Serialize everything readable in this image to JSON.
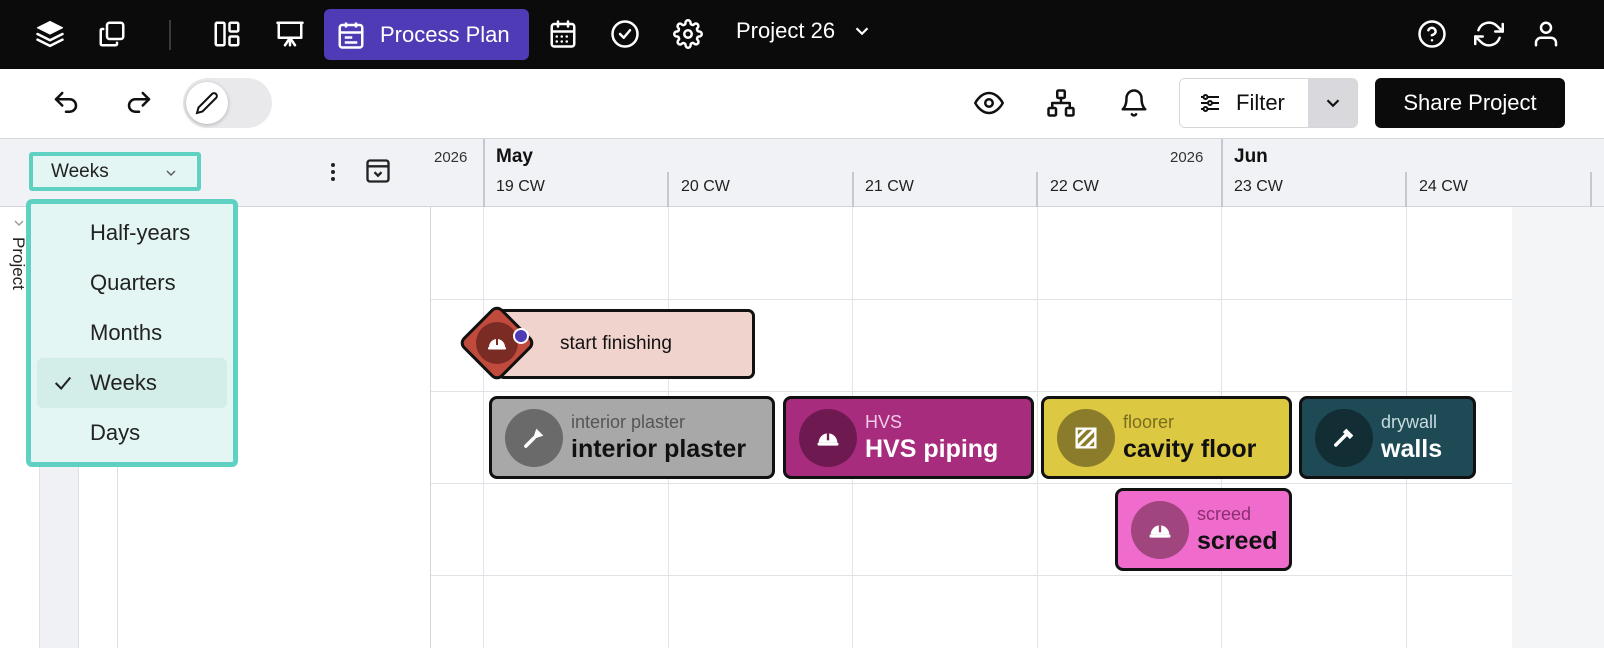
{
  "topbar": {
    "icons": [
      "layers-icon",
      "copy-icon",
      "dashboard-icon",
      "presentation-icon",
      "process-plan-icon",
      "calendar-icon",
      "check-circle-icon",
      "settings-icon",
      "help-icon",
      "refresh-icon",
      "user-icon"
    ],
    "active_tab_label": "Process Plan",
    "project_name": "Project 26"
  },
  "toolbar": {
    "filter_label": "Filter",
    "share_label": "Share Project"
  },
  "timescale": {
    "selected": "Weeks",
    "options": [
      {
        "label": "Half-years",
        "selected": false
      },
      {
        "label": "Quarters",
        "selected": false
      },
      {
        "label": "Months",
        "selected": false
      },
      {
        "label": "Weeks",
        "selected": true
      },
      {
        "label": "Days",
        "selected": false
      }
    ]
  },
  "sidebar": {
    "project_label": "Project"
  },
  "timeline": {
    "years": [
      "2026",
      "2026"
    ],
    "months": [
      "May",
      "Jun"
    ],
    "weeks": [
      "19 CW",
      "20 CW",
      "21 CW",
      "22 CW",
      "23 CW",
      "24 CW"
    ]
  },
  "milestone": {
    "label": "start finishing",
    "color": "#c04a3c"
  },
  "tasks": [
    {
      "trade": "interior plaster",
      "name": "interior plaster",
      "color": "#a8a8a8",
      "icon": "trowel-icon"
    },
    {
      "trade": "HVS",
      "name": "HVS piping",
      "color": "#a82c7e",
      "icon": "hardhat-icon"
    },
    {
      "trade": "floorer",
      "name": "cavity floor",
      "color": "#ddc842",
      "icon": "floor-tiles-icon"
    },
    {
      "trade": "drywall",
      "name": "walls",
      "color": "#1e4a55",
      "icon": "hammer-icon"
    },
    {
      "trade": "screed",
      "name": "screed",
      "color": "#ef6ccc",
      "icon": "hardhat-icon"
    }
  ]
}
